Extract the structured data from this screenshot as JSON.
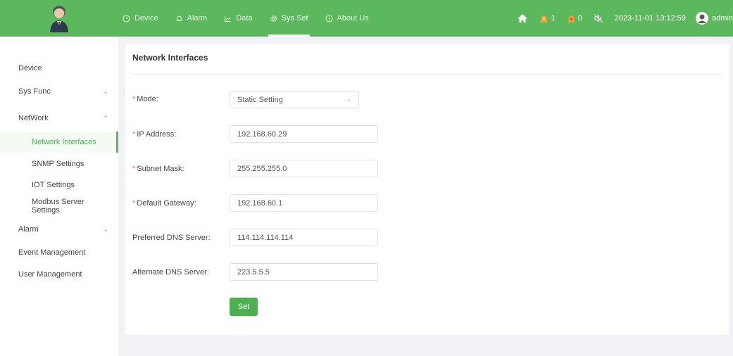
{
  "header": {
    "nav": [
      {
        "label": "Device",
        "icon": "dashboard-icon"
      },
      {
        "label": "Alarm",
        "icon": "bell-icon"
      },
      {
        "label": "Data",
        "icon": "line-chart-icon"
      },
      {
        "label": "Sys Set",
        "icon": "gear-icon",
        "active": true
      },
      {
        "label": "About Us",
        "icon": "info-icon"
      }
    ],
    "alarm_count_1": "1",
    "alarm_count_2": "0",
    "datetime": "2023-11-01 13:12:59",
    "user": "admin",
    "accent": "#5cb85c"
  },
  "sidebar": {
    "items": [
      {
        "label": "Device"
      },
      {
        "label": "Sys Func"
      },
      {
        "label": "NetWork"
      },
      {
        "label": "Network Interfaces"
      },
      {
        "label": "SNMP Settings"
      },
      {
        "label": "IOT Settings"
      },
      {
        "label": "Modbus Server Settings"
      },
      {
        "label": "Alarm"
      },
      {
        "label": "Event Management"
      },
      {
        "label": "User Management"
      }
    ]
  },
  "form": {
    "title": "Network Interfaces",
    "fields": [
      {
        "label": "Mode:",
        "value": "Static Setting",
        "required": "*"
      },
      {
        "label": "IP Address:",
        "value": "192.168.60.29",
        "required": "*"
      },
      {
        "label": "Subnet Mask:",
        "value": "255.255.255.0",
        "required": "*"
      },
      {
        "label": "Default Gateway:",
        "value": "192.168.60.1",
        "required": "*"
      },
      {
        "label": "Preferred DNS Server:",
        "value": "114.114.114.114"
      },
      {
        "label": "Alternate DNS Server:",
        "value": "223.5.5.5"
      }
    ],
    "submit_label": "Set"
  }
}
